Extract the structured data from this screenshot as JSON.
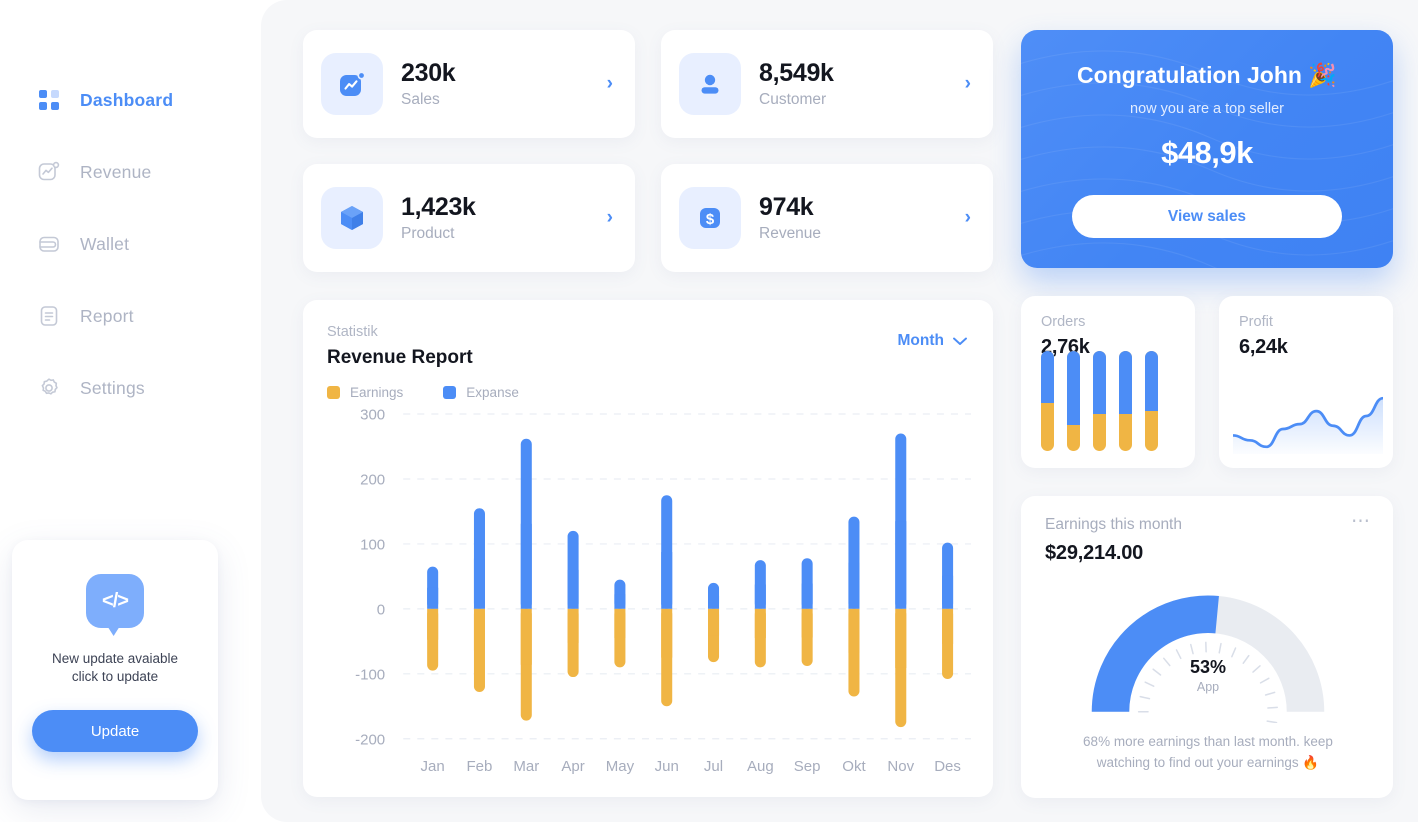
{
  "sidebar": {
    "items": [
      {
        "label": "Dashboard",
        "icon": "grid-icon",
        "active": true
      },
      {
        "label": "Revenue",
        "icon": "chart-line-icon",
        "active": false
      },
      {
        "label": "Wallet",
        "icon": "wallet-icon",
        "active": false
      },
      {
        "label": "Report",
        "icon": "document-icon",
        "active": false
      },
      {
        "label": "Settings",
        "icon": "gear-icon",
        "active": false
      }
    ],
    "update_card": {
      "icon": "code-bubble-icon",
      "code_glyph": "</>",
      "line1": "New update avaiable",
      "line2": "click to update",
      "button_label": "Update"
    }
  },
  "stats": [
    {
      "value": "230k",
      "label": "Sales",
      "icon": "trend-chart-icon",
      "chevron": "›"
    },
    {
      "value": "8,549k",
      "label": "Customer",
      "icon": "person-icon",
      "chevron": "›"
    },
    {
      "value": "1,423k",
      "label": "Product",
      "icon": "cube-icon",
      "chevron": "›"
    },
    {
      "value": "974k",
      "label": "Revenue",
      "icon": "dollar-icon",
      "chevron": "›"
    }
  ],
  "congratulation": {
    "title": "Congratulation John 🎉",
    "subtitle": "now you are a top seller",
    "amount": "$48,9k",
    "button_label": "View sales"
  },
  "report": {
    "eyebrow": "Statistik",
    "title": "Revenue Report",
    "period_label": "Month",
    "period_icon": "chevron-down-icon",
    "legend": [
      {
        "label": "Earnings",
        "color": "#f0b544"
      },
      {
        "label": "Expanse",
        "color": "#4c8df6"
      }
    ]
  },
  "mini_cards": [
    {
      "label": "Orders",
      "value": "2,76k",
      "viz": "mini-bars"
    },
    {
      "label": "Profit",
      "value": "6,24k",
      "viz": "sparkline-area"
    }
  ],
  "earnings": {
    "label": "Earnings this month",
    "menu_icon": "more-dots-icon",
    "value": "$29,214.00",
    "gauge_percent": "53%",
    "gauge_sub": "App",
    "footer_line1": "68% more earnings than last month. keep",
    "footer_line2": "watching to find out your earnings 🔥"
  },
  "colors": {
    "accent_blue": "#4c8df6",
    "earnings_orange": "#f0b544",
    "muted_text": "#a7adbd",
    "dark_text": "#13161f",
    "canvas": "#f6f7f9"
  },
  "chart_data": {
    "type": "bar",
    "title": "Revenue Report",
    "subtitle": "Statistik",
    "xlabel": "",
    "ylabel": "",
    "ylim": [
      -200,
      300
    ],
    "yticks": [
      300,
      200,
      100,
      0,
      -100,
      -200
    ],
    "grid": true,
    "legend_position": "top-left",
    "categories": [
      "Jan",
      "Feb",
      "Mar",
      "Apr",
      "May",
      "Jun",
      "Jul",
      "Aug",
      "Sep",
      "Okt",
      "Nov",
      "Des"
    ],
    "series": [
      {
        "name": "Expanse",
        "color": "#4c8df6",
        "values": [
          65,
          155,
          262,
          120,
          45,
          175,
          40,
          75,
          78,
          142,
          270,
          102
        ]
      },
      {
        "name": "Earnings",
        "color": "#f0b544",
        "values": [
          -95,
          -128,
          -172,
          -105,
          -90,
          -150,
          -82,
          -90,
          -88,
          -135,
          -182,
          -108
        ]
      }
    ]
  },
  "orders_chart": {
    "type": "bar",
    "categories": [
      "1",
      "2",
      "3",
      "4",
      "5"
    ],
    "series": [
      {
        "name": "blue",
        "color": "#4c8df6",
        "values": [
          52,
          74,
          63,
          63,
          60
        ]
      },
      {
        "name": "orange",
        "color": "#f0b544",
        "values": [
          48,
          26,
          37,
          37,
          40
        ]
      }
    ]
  },
  "profit_chart": {
    "type": "area",
    "color": "#4c8df6",
    "x": [
      0,
      1,
      2,
      3,
      4,
      5,
      6,
      7,
      8,
      9
    ],
    "values": [
      32,
      26,
      18,
      40,
      46,
      62,
      44,
      32,
      56,
      78
    ]
  },
  "gauge_chart": {
    "type": "gauge",
    "value": 53,
    "min": 0,
    "max": 100,
    "label": "App",
    "track_color": "#e9ecf1",
    "fill_color": "#4c8df6"
  }
}
